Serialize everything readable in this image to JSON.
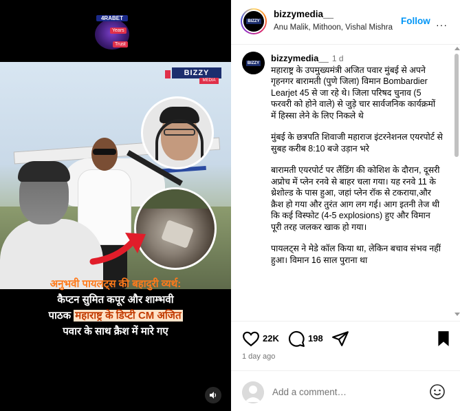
{
  "media": {
    "sponsor_name": "4RABET",
    "sponsor_badge": "Years",
    "sponsor_badge2": "Trust",
    "brand_logo_top": "BIZZY",
    "brand_logo_bottom": "MEDIA",
    "overlay_line1": "अनुभवी पायलट्स की बहादुरी व्यर्थ:",
    "overlay_line2": "कैप्टन सुमित कपूर और शाम्भवी",
    "overlay_line3_a": "पाठक ",
    "overlay_line3_highlight": "महाराष्ट्र के डिप्टी CM अजित",
    "overlay_line4": "पवार के साथ क्रैश में मारे गए",
    "sound_icon": "speaker-icon"
  },
  "header": {
    "username": "bizzymedia__",
    "subtitle": "Anu Malik, Mithoon, Vishal Mishra",
    "follow_label": "Follow",
    "more_label": "···",
    "avatar_text": "BIZZY"
  },
  "caption": {
    "username": "bizzymedia__",
    "time": "1 d",
    "paragraphs": [
      "महाराष्ट्र के उपमुख्यमंत्री अजित पवार मुंबई से अपने गृहनगर बारामती (पुणे जिला) विमान Bombardier Learjet 45 से जा रहे थे। जिला परिषद चुनाव (5 फरवरी को होने वाले) से जुड़े चार सार्वजनिक कार्यक्रमों में हिस्सा लेने के लिए निकले थे",
      "मुंबई के छत्रपति शिवाजी महाराज इंटरनेशनल एयरपोर्ट से सुबह करीब 8:10 बजे उड़ान भरे",
      "बारामती एयरपोर्ट पर लैंडिंग की कोशिश के दौरान, दूसरी अप्रोच में प्लेन रनवे से बाहर चला गया। यह रनवे 11 के थ्रेशोल्ड के पास हुआ, जहां प्लेन रॉक से टकराया,और क्रैश हो गया और तुरंत आग लग गई। आग इतनी तेज थी कि कई विस्फोट (4-5 explosions) हुए और विमान पूरी तरह जलकर खाक हो गया।",
      "पायलट्स ने मेडे कॉल किया था, लेकिन बचाव संभव नहीं हुआ। विमान 16 साल पुराना था"
    ]
  },
  "actions": {
    "like_count": "22K",
    "comment_count": "198",
    "posted_ago": "1 day ago"
  },
  "comment_box": {
    "placeholder": "Add a comment…"
  }
}
